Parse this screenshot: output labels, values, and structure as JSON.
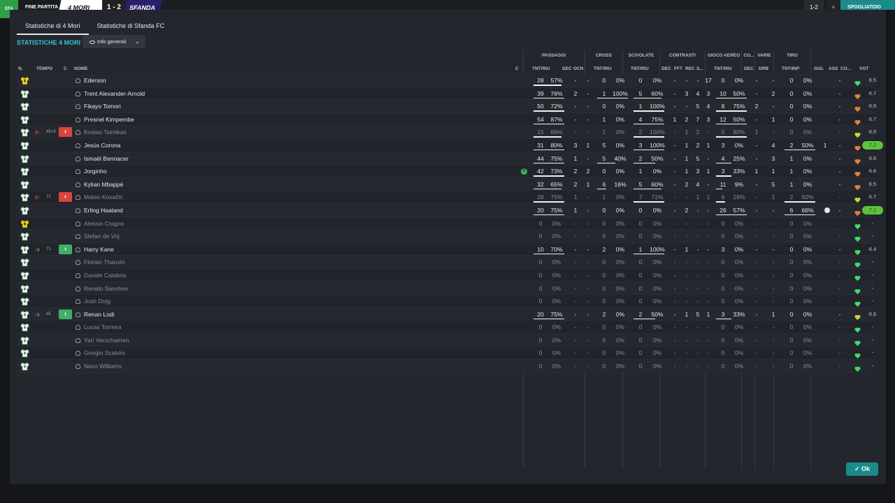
{
  "topbar": {
    "logo": "EFA",
    "status": "FINE PARTITA",
    "home_team": "4 MORI",
    "score": "1 - 2",
    "away_team": "SFANDA",
    "right_score": "1-2",
    "right_x": "×",
    "right_label": "SPOGLIATOIO"
  },
  "tabs": [
    {
      "label": "Statistiche di 4 Mori",
      "active": true
    },
    {
      "label": "Statistiche di Sfanda FC",
      "active": false
    }
  ],
  "section_title": "STATISTICHE 4 MORI",
  "dropdown": {
    "label": "Info generali"
  },
  "groups": {
    "passaggi": "PASSAGGI",
    "cross": "CROSS",
    "scivolate": "SCIVOLATE",
    "contrasti": "CONTRASTI",
    "gioco_aereo": "GIOCO AEREO",
    "co": "CO...",
    "varie": "VARIE",
    "tiro": "TIRO"
  },
  "columns": {
    "n": "N.",
    "tempo": "TEMPO",
    "c": "C",
    "nome": "NOME",
    "c2": "C",
    "pass_tnt": "TNT/RIU",
    "pass_dec": "DEC",
    "pass_ocn": "OCN",
    "cross_tnt": "TNT/RIU",
    "sciv_tnt": "TNT/RIU",
    "con_dec": "DEC",
    "con_fft": "FFT",
    "con_rec": "REC",
    "con_s": "S...",
    "aereo_tnt": "TNT/RIU",
    "co_dec": "DEC",
    "varie_drb": "DRB",
    "tiro_tnt": "TNT\\INP",
    "gol": "GOL",
    "ass": "ASS",
    "co2": "CO...",
    "vot": "VOT"
  },
  "players": [
    {
      "name": "Ederson",
      "gk": true,
      "dim": false,
      "sub": "",
      "time": "",
      "captain": false,
      "pass": [
        "28",
        "57%"
      ],
      "pdec": "-",
      "pocn": "-",
      "cross": [
        "0",
        "0%"
      ],
      "sciv": [
        "0",
        "0%"
      ],
      "cdec": "-",
      "cfft": "-",
      "crec": "-",
      "cs": "17",
      "aereo": [
        "0",
        "0%"
      ],
      "codec": "-",
      "drb": "-",
      "tiro": [
        "0",
        "0%"
      ],
      "gol": "",
      "ass": "-",
      "heart": "green",
      "vot": "6.5",
      "top": false,
      "ul": {
        "pass": 0.9,
        "cross": 0,
        "sciv": 0,
        "aereo": 0,
        "tiro": 0
      }
    },
    {
      "name": "Trent Alexander-Arnold",
      "gk": false,
      "dim": false,
      "sub": "",
      "time": "",
      "captain": false,
      "pass": [
        "39",
        "76%"
      ],
      "pdec": "2",
      "pocn": "-",
      "cross": [
        "1",
        "100%"
      ],
      "sciv": [
        "5",
        "60%"
      ],
      "cdec": "-",
      "cfft": "3",
      "crec": "4",
      "cs": "3",
      "aereo": [
        "10",
        "50%"
      ],
      "codec": "-",
      "drb": "2",
      "tiro": [
        "0",
        "0%"
      ],
      "gol": "",
      "ass": "-",
      "heart": "orange",
      "vot": "6.7",
      "top": false,
      "ul": {
        "pass": 1,
        "cross": 1,
        "sciv": 0.9,
        "aereo": 1,
        "tiro": 0
      }
    },
    {
      "name": "Fikayo Tomori",
      "gk": false,
      "dim": false,
      "sub": "",
      "time": "",
      "captain": false,
      "pass": [
        "50",
        "72%"
      ],
      "pdec": "-",
      "pocn": "-",
      "cross": [
        "0",
        "0%"
      ],
      "sciv": [
        "1",
        "100%"
      ],
      "cdec": "-",
      "cfft": "-",
      "crec": "5",
      "cs": "4",
      "aereo": [
        "8",
        "75%"
      ],
      "codec": "2",
      "drb": "-",
      "tiro": [
        "0",
        "0%"
      ],
      "gol": "",
      "ass": "-",
      "heart": "orange",
      "vot": "6.9",
      "top": false,
      "ul": {
        "pass": 1,
        "cross": 0,
        "sciv": 1,
        "aereo": 1,
        "tiro": 0
      }
    },
    {
      "name": "Presnel Kimpembe",
      "gk": false,
      "dim": false,
      "sub": "",
      "time": "",
      "captain": false,
      "pass": [
        "54",
        "87%"
      ],
      "pdec": "-",
      "pocn": "-",
      "cross": [
        "1",
        "0%"
      ],
      "sciv": [
        "4",
        "75%"
      ],
      "cdec": "1",
      "cfft": "2",
      "crec": "7",
      "cs": "3",
      "aereo": [
        "12",
        "50%"
      ],
      "codec": "-",
      "drb": "1",
      "tiro": [
        "0",
        "0%"
      ],
      "gol": "",
      "ass": "-",
      "heart": "orange",
      "vot": "6.7",
      "top": false,
      "ul": {
        "pass": 1,
        "cross": 0,
        "sciv": 1,
        "aereo": 1,
        "tiro": 0
      }
    },
    {
      "name": "Kostas Tsimikas",
      "gk": false,
      "dim": true,
      "sub": "out",
      "time": "45+3",
      "captain": false,
      "pass": [
        "15",
        "66%"
      ],
      "pdec": "-",
      "pocn": "-",
      "cross": [
        "1",
        "0%"
      ],
      "sciv": [
        "2",
        "100%"
      ],
      "cdec": "-",
      "cfft": "1",
      "crec": "2",
      "cs": "-",
      "aereo": [
        "5",
        "80%"
      ],
      "codec": "1",
      "drb": "-",
      "tiro": [
        "0",
        "0%"
      ],
      "gol": "",
      "ass": "-",
      "heart": "yellow",
      "vot": "6.5",
      "top": false,
      "ul": {
        "pass": 0.9,
        "cross": 0,
        "sciv": 1,
        "aereo": 1,
        "tiro": 0
      }
    },
    {
      "name": "Jesús Corona",
      "gk": false,
      "dim": false,
      "sub": "",
      "time": "",
      "captain": false,
      "pass": [
        "31",
        "80%"
      ],
      "pdec": "3",
      "pocn": "1",
      "cross": [
        "5",
        "0%"
      ],
      "sciv": [
        "3",
        "100%"
      ],
      "cdec": "-",
      "cfft": "1",
      "crec": "2",
      "cs": "1",
      "aereo": [
        "3",
        "0%"
      ],
      "codec": "-",
      "drb": "4",
      "tiro": [
        "2",
        "50%"
      ],
      "gol": "1",
      "ass": "-",
      "heart": "orange",
      "vot": "7.2",
      "top": true,
      "ul": {
        "pass": 1,
        "cross": 0,
        "sciv": 1,
        "aereo": 0,
        "tiro": 1
      }
    },
    {
      "name": "Ismaël Bennacer",
      "gk": false,
      "dim": false,
      "sub": "",
      "time": "",
      "captain": false,
      "pass": [
        "44",
        "75%"
      ],
      "pdec": "1",
      "pocn": "-",
      "cross": [
        "5",
        "40%"
      ],
      "sciv": [
        "2",
        "50%"
      ],
      "cdec": "-",
      "cfft": "1",
      "crec": "5",
      "cs": "-",
      "aereo": [
        "4",
        "25%"
      ],
      "codec": "-",
      "drb": "3",
      "tiro": [
        "1",
        "0%"
      ],
      "gol": "",
      "ass": "-",
      "heart": "orange",
      "vot": "6.6",
      "top": false,
      "ul": {
        "pass": 1,
        "cross": 0.6,
        "sciv": 0.7,
        "aereo": 0.5,
        "tiro": 0
      }
    },
    {
      "name": "Jorginho",
      "gk": false,
      "dim": false,
      "sub": "",
      "time": "",
      "captain": true,
      "pass": [
        "42",
        "73%"
      ],
      "pdec": "2",
      "pocn": "2",
      "cross": [
        "0",
        "0%"
      ],
      "sciv": [
        "1",
        "0%"
      ],
      "cdec": "-",
      "cfft": "1",
      "crec": "3",
      "cs": "1",
      "aereo": [
        "3",
        "33%"
      ],
      "codec": "1",
      "drb": "1",
      "tiro": [
        "1",
        "0%"
      ],
      "gol": "",
      "ass": "-",
      "heart": "orange",
      "vot": "6.6",
      "top": false,
      "ul": {
        "pass": 1,
        "cross": 0,
        "sciv": 0,
        "aereo": 0.5,
        "tiro": 0
      }
    },
    {
      "name": "Kylian Mbappé",
      "gk": false,
      "dim": false,
      "sub": "",
      "time": "",
      "captain": false,
      "pass": [
        "32",
        "65%"
      ],
      "pdec": "2",
      "pocn": "1",
      "cross": [
        "6",
        "16%"
      ],
      "sciv": [
        "5",
        "60%"
      ],
      "cdec": "-",
      "cfft": "2",
      "crec": "4",
      "cs": "-",
      "aereo": [
        "11",
        "9%"
      ],
      "codec": "-",
      "drb": "5",
      "tiro": [
        "1",
        "0%"
      ],
      "gol": "",
      "ass": "-",
      "heart": "orange",
      "vot": "6.5",
      "top": false,
      "ul": {
        "pass": 0.9,
        "cross": 0.3,
        "sciv": 0.9,
        "aereo": 0.2,
        "tiro": 0
      }
    },
    {
      "name": "Mateo Kovačić",
      "gk": false,
      "dim": true,
      "sub": "out",
      "time": "71",
      "captain": false,
      "pass": [
        "28",
        "75%"
      ],
      "pdec": "1",
      "pocn": "-",
      "cross": [
        "1",
        "0%"
      ],
      "sciv": [
        "7",
        "71%"
      ],
      "cdec": "-",
      "cfft": "-",
      "crec": "1",
      "cs": "1",
      "aereo": [
        "6",
        "16%"
      ],
      "codec": "-",
      "drb": "1",
      "tiro": [
        "2",
        "50%"
      ],
      "gol": "",
      "ass": "-",
      "heart": "yellow",
      "vot": "6.7",
      "top": false,
      "ul": {
        "pass": 1,
        "cross": 0,
        "sciv": 1,
        "aereo": 0.3,
        "tiro": 1
      }
    },
    {
      "name": "Erling Haaland",
      "gk": false,
      "dim": false,
      "sub": "",
      "time": "",
      "captain": false,
      "pass": [
        "20",
        "75%"
      ],
      "pdec": "1",
      "pocn": "-",
      "cross": [
        "0",
        "0%"
      ],
      "sciv": [
        "0",
        "0%"
      ],
      "cdec": "-",
      "cfft": "2",
      "crec": "-",
      "cs": "-",
      "aereo": [
        "26",
        "57%"
      ],
      "codec": "-",
      "drb": "-",
      "tiro": [
        "6",
        "66%"
      ],
      "gol": "ball",
      "ass": "-",
      "heart": "orange",
      "vot": "7.1",
      "top": true,
      "ul": {
        "pass": 1,
        "cross": 0,
        "sciv": 0,
        "aereo": 1,
        "tiro": 1
      }
    },
    {
      "name": "Alessio Cragno",
      "gk": true,
      "dim": true,
      "sub": "",
      "time": "",
      "captain": false,
      "pass": [
        "0",
        "0%"
      ],
      "pdec": "-",
      "pocn": "-",
      "cross": [
        "0",
        "0%"
      ],
      "sciv": [
        "0",
        "0%"
      ],
      "cdec": "-",
      "cfft": "-",
      "crec": "-",
      "cs": "-",
      "aereo": [
        "0",
        "0%"
      ],
      "codec": "-",
      "drb": "-",
      "tiro": [
        "0",
        "0%"
      ],
      "gol": "",
      "ass": "-",
      "heart": "green",
      "vot": "-",
      "top": false,
      "ul": {
        "pass": 0,
        "cross": 0,
        "sciv": 0,
        "aereo": 0,
        "tiro": 0
      }
    },
    {
      "name": "Stefan de Vrij",
      "gk": false,
      "dim": true,
      "sub": "",
      "time": "",
      "captain": false,
      "pass": [
        "0",
        "0%"
      ],
      "pdec": "-",
      "pocn": "-",
      "cross": [
        "0",
        "0%"
      ],
      "sciv": [
        "0",
        "0%"
      ],
      "cdec": "-",
      "cfft": "-",
      "crec": "-",
      "cs": "-",
      "aereo": [
        "0",
        "0%"
      ],
      "codec": "-",
      "drb": "-",
      "tiro": [
        "0",
        "0%"
      ],
      "gol": "",
      "ass": "-",
      "heart": "green",
      "vot": "-",
      "top": false,
      "ul": {
        "pass": 0,
        "cross": 0,
        "sciv": 0,
        "aereo": 0,
        "tiro": 0
      }
    },
    {
      "name": "Harry Kane",
      "gk": false,
      "dim": false,
      "sub": "in",
      "time": "71",
      "captain": false,
      "pass": [
        "10",
        "70%"
      ],
      "pdec": "-",
      "pocn": "-",
      "cross": [
        "2",
        "0%"
      ],
      "sciv": [
        "1",
        "100%"
      ],
      "cdec": "-",
      "cfft": "1",
      "crec": "-",
      "cs": "-",
      "aereo": [
        "3",
        "0%"
      ],
      "codec": "-",
      "drb": "-",
      "tiro": [
        "0",
        "0%"
      ],
      "gol": "",
      "ass": "-",
      "heart": "green",
      "vot": "6.4",
      "top": false,
      "ul": {
        "pass": 1,
        "cross": 0,
        "sciv": 1,
        "aereo": 0,
        "tiro": 0
      }
    },
    {
      "name": "Florian Thauvin",
      "gk": false,
      "dim": true,
      "sub": "",
      "time": "",
      "captain": false,
      "pass": [
        "0",
        "0%"
      ],
      "pdec": "-",
      "pocn": "-",
      "cross": [
        "0",
        "0%"
      ],
      "sciv": [
        "0",
        "0%"
      ],
      "cdec": "-",
      "cfft": "-",
      "crec": "-",
      "cs": "-",
      "aereo": [
        "0",
        "0%"
      ],
      "codec": "-",
      "drb": "-",
      "tiro": [
        "0",
        "0%"
      ],
      "gol": "",
      "ass": "-",
      "heart": "green",
      "vot": "-",
      "top": false,
      "ul": {
        "pass": 0,
        "cross": 0,
        "sciv": 0,
        "aereo": 0,
        "tiro": 0
      }
    },
    {
      "name": "Davide Calabria",
      "gk": false,
      "dim": true,
      "sub": "",
      "time": "",
      "captain": false,
      "pass": [
        "0",
        "0%"
      ],
      "pdec": "-",
      "pocn": "-",
      "cross": [
        "0",
        "0%"
      ],
      "sciv": [
        "0",
        "0%"
      ],
      "cdec": "-",
      "cfft": "-",
      "crec": "-",
      "cs": "-",
      "aereo": [
        "0",
        "0%"
      ],
      "codec": "-",
      "drb": "-",
      "tiro": [
        "0",
        "0%"
      ],
      "gol": "",
      "ass": "-",
      "heart": "green",
      "vot": "-",
      "top": false,
      "ul": {
        "pass": 0,
        "cross": 0,
        "sciv": 0,
        "aereo": 0,
        "tiro": 0
      }
    },
    {
      "name": "Renato Sanches",
      "gk": false,
      "dim": true,
      "sub": "",
      "time": "",
      "captain": false,
      "pass": [
        "0",
        "0%"
      ],
      "pdec": "-",
      "pocn": "-",
      "cross": [
        "0",
        "0%"
      ],
      "sciv": [
        "0",
        "0%"
      ],
      "cdec": "-",
      "cfft": "-",
      "crec": "-",
      "cs": "-",
      "aereo": [
        "0",
        "0%"
      ],
      "codec": "-",
      "drb": "-",
      "tiro": [
        "0",
        "0%"
      ],
      "gol": "",
      "ass": "-",
      "heart": "green",
      "vot": "-",
      "top": false,
      "ul": {
        "pass": 0,
        "cross": 0,
        "sciv": 0,
        "aereo": 0,
        "tiro": 0
      }
    },
    {
      "name": "Josh Doig",
      "gk": false,
      "dim": true,
      "sub": "",
      "time": "",
      "captain": false,
      "pass": [
        "0",
        "0%"
      ],
      "pdec": "-",
      "pocn": "-",
      "cross": [
        "0",
        "0%"
      ],
      "sciv": [
        "0",
        "0%"
      ],
      "cdec": "-",
      "cfft": "-",
      "crec": "-",
      "cs": "-",
      "aereo": [
        "0",
        "0%"
      ],
      "codec": "-",
      "drb": "-",
      "tiro": [
        "0",
        "0%"
      ],
      "gol": "",
      "ass": "-",
      "heart": "green",
      "vot": "-",
      "top": false,
      "ul": {
        "pass": 0,
        "cross": 0,
        "sciv": 0,
        "aereo": 0,
        "tiro": 0
      }
    },
    {
      "name": "Renan Lodi",
      "gk": false,
      "dim": false,
      "sub": "in",
      "time": "45",
      "captain": false,
      "pass": [
        "20",
        "75%"
      ],
      "pdec": "-",
      "pocn": "-",
      "cross": [
        "2",
        "0%"
      ],
      "sciv": [
        "2",
        "50%"
      ],
      "cdec": "-",
      "cfft": "1",
      "crec": "5",
      "cs": "1",
      "aereo": [
        "3",
        "33%"
      ],
      "codec": "-",
      "drb": "1",
      "tiro": [
        "0",
        "0%"
      ],
      "gol": "",
      "ass": "-",
      "heart": "yellow",
      "vot": "6.6",
      "top": false,
      "ul": {
        "pass": 1,
        "cross": 0,
        "sciv": 0.7,
        "aereo": 0.5,
        "tiro": 0
      }
    },
    {
      "name": "Lucas Torreira",
      "gk": false,
      "dim": true,
      "sub": "",
      "time": "",
      "captain": false,
      "pass": [
        "0",
        "0%"
      ],
      "pdec": "-",
      "pocn": "-",
      "cross": [
        "0",
        "0%"
      ],
      "sciv": [
        "0",
        "0%"
      ],
      "cdec": "-",
      "cfft": "-",
      "crec": "-",
      "cs": "-",
      "aereo": [
        "0",
        "0%"
      ],
      "codec": "-",
      "drb": "-",
      "tiro": [
        "0",
        "0%"
      ],
      "gol": "",
      "ass": "-",
      "heart": "green",
      "vot": "-",
      "top": false,
      "ul": {
        "pass": 0,
        "cross": 0,
        "sciv": 0,
        "aereo": 0,
        "tiro": 0
      }
    },
    {
      "name": "Yari Verschaeren",
      "gk": false,
      "dim": true,
      "sub": "",
      "time": "",
      "captain": false,
      "pass": [
        "0",
        "0%"
      ],
      "pdec": "-",
      "pocn": "-",
      "cross": [
        "0",
        "0%"
      ],
      "sciv": [
        "0",
        "0%"
      ],
      "cdec": "-",
      "cfft": "-",
      "crec": "-",
      "cs": "-",
      "aereo": [
        "0",
        "0%"
      ],
      "codec": "-",
      "drb": "-",
      "tiro": [
        "0",
        "0%"
      ],
      "gol": "",
      "ass": "-",
      "heart": "green",
      "vot": "-",
      "top": false,
      "ul": {
        "pass": 0,
        "cross": 0,
        "sciv": 0,
        "aereo": 0,
        "tiro": 0
      }
    },
    {
      "name": "Giorgio Scalvini",
      "gk": false,
      "dim": true,
      "sub": "",
      "time": "",
      "captain": false,
      "pass": [
        "0",
        "0%"
      ],
      "pdec": "-",
      "pocn": "-",
      "cross": [
        "0",
        "0%"
      ],
      "sciv": [
        "0",
        "0%"
      ],
      "cdec": "-",
      "cfft": "-",
      "crec": "-",
      "cs": "-",
      "aereo": [
        "0",
        "0%"
      ],
      "codec": "-",
      "drb": "-",
      "tiro": [
        "0",
        "0%"
      ],
      "gol": "",
      "ass": "-",
      "heart": "green",
      "vot": "-",
      "top": false,
      "ul": {
        "pass": 0,
        "cross": 0,
        "sciv": 0,
        "aereo": 0,
        "tiro": 0
      }
    },
    {
      "name": "Neco Williams",
      "gk": false,
      "dim": true,
      "sub": "",
      "time": "",
      "captain": false,
      "pass": [
        "0",
        "0%"
      ],
      "pdec": "-",
      "pocn": "-",
      "cross": [
        "0",
        "0%"
      ],
      "sciv": [
        "0",
        "0%"
      ],
      "cdec": "-",
      "cfft": "-",
      "crec": "-",
      "cs": "-",
      "aereo": [
        "0",
        "0%"
      ],
      "codec": "-",
      "drb": "-",
      "tiro": [
        "0",
        "0%"
      ],
      "gol": "",
      "ass": "-",
      "heart": "green",
      "vot": "-",
      "top": false,
      "ul": {
        "pass": 0,
        "cross": 0,
        "sciv": 0,
        "aereo": 0,
        "tiro": 0
      }
    }
  ],
  "colors": {
    "accent": "#2fc4d6",
    "ok_button": "#1b8a8a",
    "sub_in": "#3fae6a",
    "sub_out": "#d9463d",
    "heart_green": "#3fdc6a",
    "heart_orange": "#d8853a",
    "heart_yellow": "#c7d83a",
    "top_rating": "#5cc43a"
  },
  "ok_button": {
    "label": "Ok"
  }
}
